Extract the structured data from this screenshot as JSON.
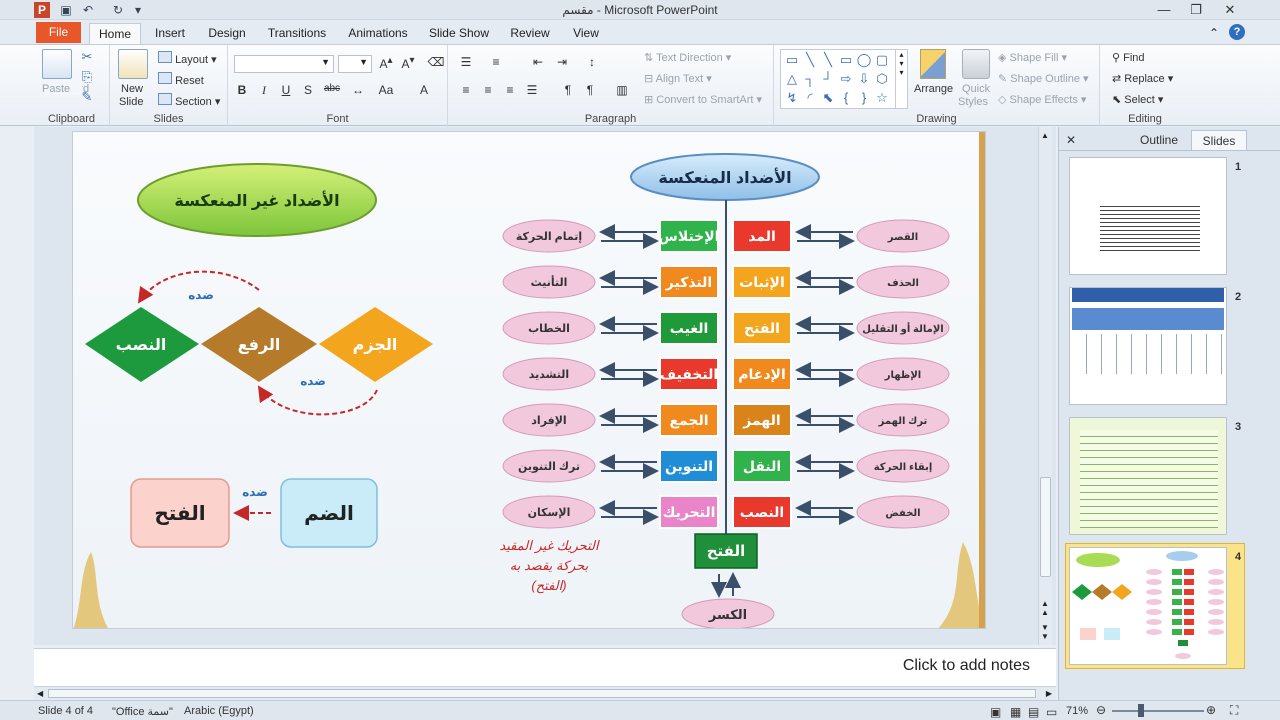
{
  "window": {
    "title": "مقسم - Microsoft PowerPoint"
  },
  "tabs": [
    "File",
    "Home",
    "Insert",
    "Design",
    "Transitions",
    "Animations",
    "Slide Show",
    "Review",
    "View"
  ],
  "ribbon": {
    "clipboard": {
      "name": "Clipboard",
      "paste": "Paste"
    },
    "slides": {
      "name": "Slides",
      "new_slide": "New",
      "new_slide2": "Slide",
      "layout": "Layout",
      "reset": "Reset",
      "section": "Section"
    },
    "font": {
      "name": "Font"
    },
    "paragraph": {
      "name": "Paragraph",
      "text_direction": "Text Direction",
      "align_text": "Align Text",
      "convert_smartart": "Convert to SmartArt"
    },
    "drawing": {
      "name": "Drawing",
      "arrange": "Arrange",
      "quick": "Quick",
      "styles": "Styles",
      "shape_fill": "Shape Fill",
      "shape_outline": "Shape Outline",
      "shape_effects": "Shape Effects"
    },
    "editing": {
      "name": "Editing",
      "find": "Find",
      "replace": "Replace",
      "select": "Select"
    }
  },
  "slide": {
    "left_title": "الأضداد غير المنعكسة",
    "right_title": "الأضداد المنعكسة",
    "diamonds": [
      "النصب",
      "الرفع",
      "الجزم"
    ],
    "opp_label": "ضده",
    "box_left": "الفتح",
    "box_right": "الضم",
    "rows": [
      {
        "far_left": "إتمام الحركة",
        "green": "الإختلاس",
        "red": "المد",
        "far_right": "القصر"
      },
      {
        "far_left": "التأنيث",
        "green": "التذكير",
        "red": "الإثبات",
        "far_right": "الحذف"
      },
      {
        "far_left": "الخطاب",
        "green": "الغيب",
        "red": "الفتح",
        "far_right": "الإمالة أو التقليل"
      },
      {
        "far_left": "التشديد",
        "green": "التخفيف",
        "red": "الإدغام",
        "far_right": "الإظهار"
      },
      {
        "far_left": "الإفراد",
        "green": "الجمع",
        "red": "الهمز",
        "far_right": "ترك الهمز"
      },
      {
        "far_left": "ترك التنوين",
        "green": "التنوين",
        "red": "النقل",
        "far_right": "إبقاء الحركة"
      },
      {
        "far_left": "الإسكان",
        "green": "التحريك",
        "red": "النصب",
        "far_right": "الخفض"
      }
    ],
    "bottom_box": "الفتح",
    "bottom_ellipse": "الكسر",
    "note_line1": "التحريك غير المقيد",
    "note_line2": "بحركة يقصد به",
    "note_line3": "(الفتح)"
  },
  "notes": {
    "placeholder": "Click to add notes"
  },
  "panel": {
    "tab_outline": "Outline",
    "tab_slides": "Slides",
    "numbers": [
      "1",
      "2",
      "3",
      "4"
    ]
  },
  "status": {
    "slide": "Slide 4 of 4",
    "theme": "\"Office سمة\"",
    "language": "Arabic (Egypt)",
    "zoom": "71%"
  }
}
